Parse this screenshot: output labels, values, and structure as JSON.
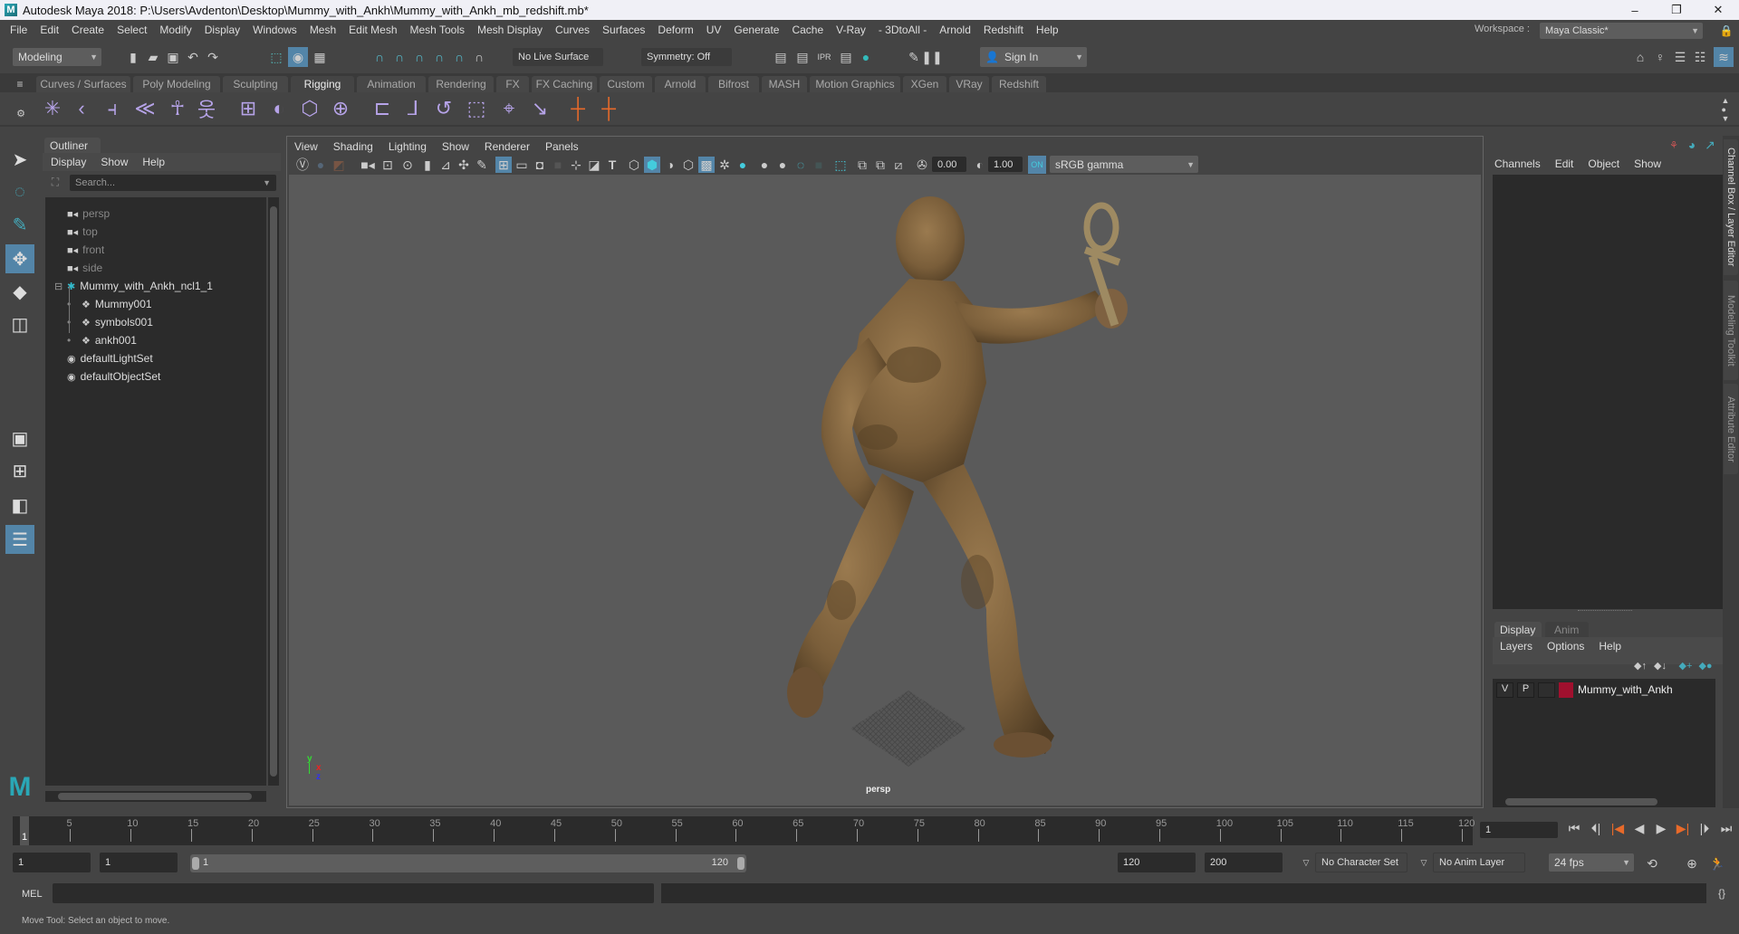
{
  "window": {
    "title": "Autodesk Maya 2018: P:\\Users\\Avdenton\\Desktop\\Mummy_with_Ankh\\Mummy_with_Ankh_mb_redshift.mb*",
    "minimize": "–",
    "restore": "❐",
    "close": "✕"
  },
  "menubar": [
    "File",
    "Edit",
    "Create",
    "Select",
    "Modify",
    "Display",
    "Windows",
    "Mesh",
    "Edit Mesh",
    "Mesh Tools",
    "Mesh Display",
    "Curves",
    "Surfaces",
    "Deform",
    "UV",
    "Generate",
    "Cache",
    "V-Ray",
    "- 3DtoAll -",
    "Arnold",
    "Redshift",
    "Help"
  ],
  "workspace": {
    "label": "Workspace :",
    "value": "Maya Classic*"
  },
  "statusline": {
    "menuset": "Modeling",
    "live_surface": "No Live Surface",
    "symmetry": "Symmetry: Off",
    "sign_in": "Sign In"
  },
  "shelf": {
    "tabs": [
      "Curves / Surfaces",
      "Poly Modeling",
      "Sculpting",
      "Rigging",
      "Animation",
      "Rendering",
      "FX",
      "FX Caching",
      "Custom",
      "Arnold",
      "Bifrost",
      "MASH",
      "Motion Graphics",
      "XGen",
      "VRay",
      "Redshift"
    ],
    "active_tab": "Rigging"
  },
  "outliner": {
    "tab": "Outliner",
    "menu": [
      "Display",
      "Show",
      "Help"
    ],
    "search_placeholder": "Search...",
    "items": [
      {
        "label": "persp",
        "icon": "camera-icon",
        "dim": true,
        "indent": 0
      },
      {
        "label": "top",
        "icon": "camera-icon",
        "dim": true,
        "indent": 0
      },
      {
        "label": "front",
        "icon": "camera-icon",
        "dim": true,
        "indent": 0
      },
      {
        "label": "side",
        "icon": "camera-icon",
        "dim": true,
        "indent": 0
      },
      {
        "label": "Mummy_with_Ankh_ncl1_1",
        "icon": "group-icon",
        "dim": false,
        "indent": 0,
        "expanded": true
      },
      {
        "label": "Mummy001",
        "icon": "mesh-icon",
        "dim": false,
        "indent": 1
      },
      {
        "label": "symbols001",
        "icon": "mesh-icon",
        "dim": false,
        "indent": 1
      },
      {
        "label": "ankh001",
        "icon": "mesh-icon",
        "dim": false,
        "indent": 1
      },
      {
        "label": "defaultLightSet",
        "icon": "set-icon",
        "dim": false,
        "indent": 0
      },
      {
        "label": "defaultObjectSet",
        "icon": "set-icon",
        "dim": false,
        "indent": 0
      }
    ]
  },
  "viewport": {
    "menu": [
      "View",
      "Shading",
      "Lighting",
      "Show",
      "Renderer",
      "Panels"
    ],
    "exposure": "0.00",
    "gamma": "1.00",
    "color_space": "sRGB gamma",
    "camera_label": "persp",
    "axis": {
      "x": "x",
      "y": "y",
      "z": "z"
    }
  },
  "channelbox": {
    "menu": [
      "Channels",
      "Edit",
      "Object",
      "Show"
    ]
  },
  "layer_editor": {
    "tabs": [
      "Display",
      "Anim"
    ],
    "active_tab": "Display",
    "menu": [
      "Layers",
      "Options",
      "Help"
    ],
    "layers": [
      {
        "v": "V",
        "p": "P",
        "color": "#a0102e",
        "name": "Mummy_with_Ankh"
      }
    ]
  },
  "side_tabs": [
    "Channel Box / Layer Editor",
    "Modeling Toolkit",
    "Attribute Editor"
  ],
  "timeline": {
    "ticks": [
      5,
      10,
      15,
      20,
      25,
      30,
      35,
      40,
      45,
      50,
      55,
      60,
      65,
      70,
      75,
      80,
      85,
      90,
      95,
      100,
      105,
      110,
      115,
      120
    ],
    "start": 1,
    "end": 120,
    "current_frame": "1",
    "current_frame_marker": "1"
  },
  "range": {
    "start_time": "1",
    "playback_start": "1",
    "range_start_label": "1",
    "range_end_label": "120",
    "playback_end": "120",
    "end_time": "200",
    "character_set": "No Character Set",
    "anim_layer": "No Anim Layer",
    "fps": "24 fps"
  },
  "commandline": {
    "label": "MEL"
  },
  "helpline": {
    "text": "Move Tool: Select an object to move."
  }
}
